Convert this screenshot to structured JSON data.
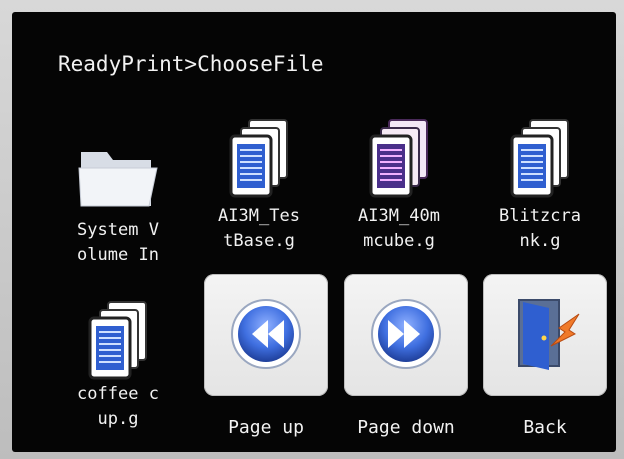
{
  "breadcrumb": "ReadyPrint>ChooseFile",
  "files": [
    {
      "name_line1": "System V",
      "name_line2": "olume In",
      "icon": "folder-icon"
    },
    {
      "name_line1": "AI3M_Tes",
      "name_line2": "tBase.g",
      "icon": "gcode-file-icon"
    },
    {
      "name_line1": "AI3M_40m",
      "name_line2": "mcube.g",
      "icon": "gcode-file-icon"
    },
    {
      "name_line1": "Blitzcra",
      "name_line2": "nk.g",
      "icon": "gcode-file-icon"
    },
    {
      "name_line1": "coffee c",
      "name_line2": "up.g",
      "icon": "gcode-file-icon"
    }
  ],
  "buttons": {
    "page_up": "Page up",
    "page_down": "Page down",
    "back": "Back"
  },
  "colors": {
    "screen_bg": "#050505",
    "icon_blue": "#2f5fd0",
    "tile_bg": "#f0f0f0",
    "text": "#f2f2f2"
  }
}
